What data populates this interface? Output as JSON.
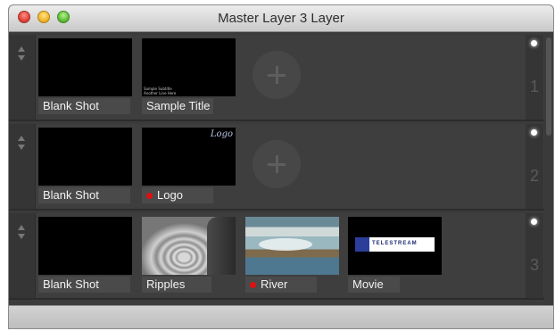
{
  "window": {
    "title": "Master Layer 3 Layer"
  },
  "layers": [
    {
      "number": "1",
      "clips": [
        {
          "name": "Blank Shot",
          "live": false
        },
        {
          "name": "Sample Title",
          "live": false,
          "thumb_lines": [
            "Sample Subtitle",
            "Another Line Here"
          ]
        }
      ]
    },
    {
      "number": "2",
      "clips": [
        {
          "name": "Blank Shot",
          "live": false
        },
        {
          "name": "Logo",
          "live": true,
          "thumb_text": "Logo"
        }
      ]
    },
    {
      "number": "3",
      "clips": [
        {
          "name": "Blank Shot",
          "live": false
        },
        {
          "name": "Ripples",
          "live": false
        },
        {
          "name": "River",
          "live": true
        },
        {
          "name": "Movie",
          "live": false,
          "thumb_text": "TELESTREAM"
        }
      ]
    }
  ],
  "colors": {
    "live_indicator": "#e01010",
    "layer_on_light": "#ffffff"
  }
}
